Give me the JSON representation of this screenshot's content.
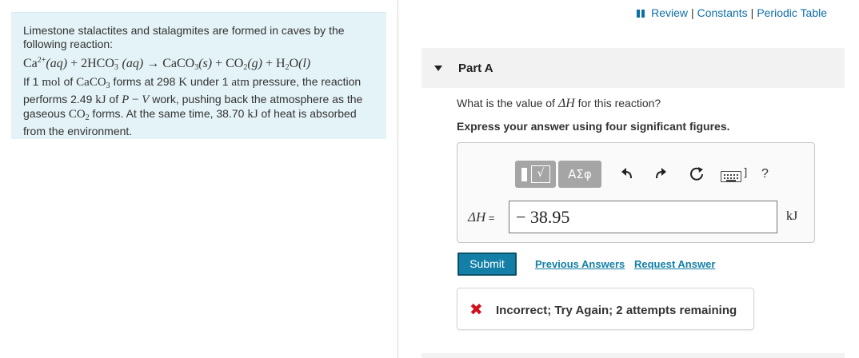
{
  "problem": {
    "intro": "Limestone stalactites and stalagmites are formed in caves by the following reaction:",
    "equation": "Ca²⁺(aq) + 2HCO₃⁻(aq) → CaCO₃(s) + CO₂(g) + H₂O(l)",
    "details": "If 1 mol of CaCO3 forms at 298 K under 1 atm pressure, the reaction performs 2.49 kJ of P − V work, pushing back the atmosphere as the gaseous CO2 forms. At the same time, 38.70 kJ of heat is absorbed from the environment."
  },
  "toplinks": {
    "review": "Review",
    "sep": "|",
    "constants": "Constants",
    "periodic_table": "Periodic Table"
  },
  "part": {
    "label": "Part A",
    "question_prefix": "What is the value of ",
    "question_symbol": "ΔH",
    "question_suffix": " for this reaction?",
    "instruction": "Express your answer using four significant figures."
  },
  "toolbar": {
    "templates_radical": "√",
    "symbols_label": "ΑΣφ",
    "help": "?"
  },
  "answer": {
    "lhs_symbol": "ΔH",
    "lhs_equals": " =",
    "value": "− 38.95",
    "unit": "kJ"
  },
  "actions": {
    "submit": "Submit",
    "previous_answers": "Previous Answers",
    "request_answer": "Request Answer"
  },
  "feedback": {
    "icon": "✖",
    "message": "Incorrect; Try Again; 2 attempts remaining",
    "color": "#d0101e"
  }
}
